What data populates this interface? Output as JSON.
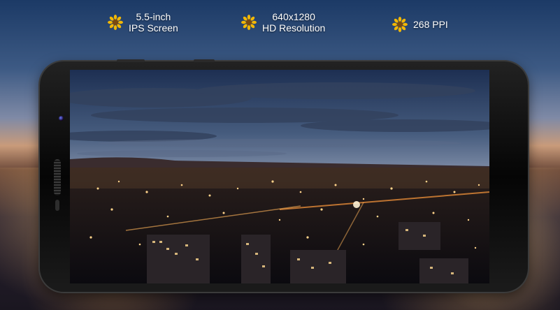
{
  "features": [
    {
      "icon": "sunflower-icon",
      "line1": "5.5-inch",
      "line2": "IPS Screen"
    },
    {
      "icon": "sunflower-icon",
      "line1": "640x1280",
      "line2": "HD Resolution"
    },
    {
      "icon": "sunflower-icon",
      "line1": "268 PPI",
      "line2": ""
    }
  ],
  "colors": {
    "text": "#ffffff",
    "icon_petal": "#f2b705",
    "icon_center": "#7a4a10",
    "phone_body": "#0a0a0a"
  },
  "screen": {
    "content": "night city skyline at dusk"
  }
}
